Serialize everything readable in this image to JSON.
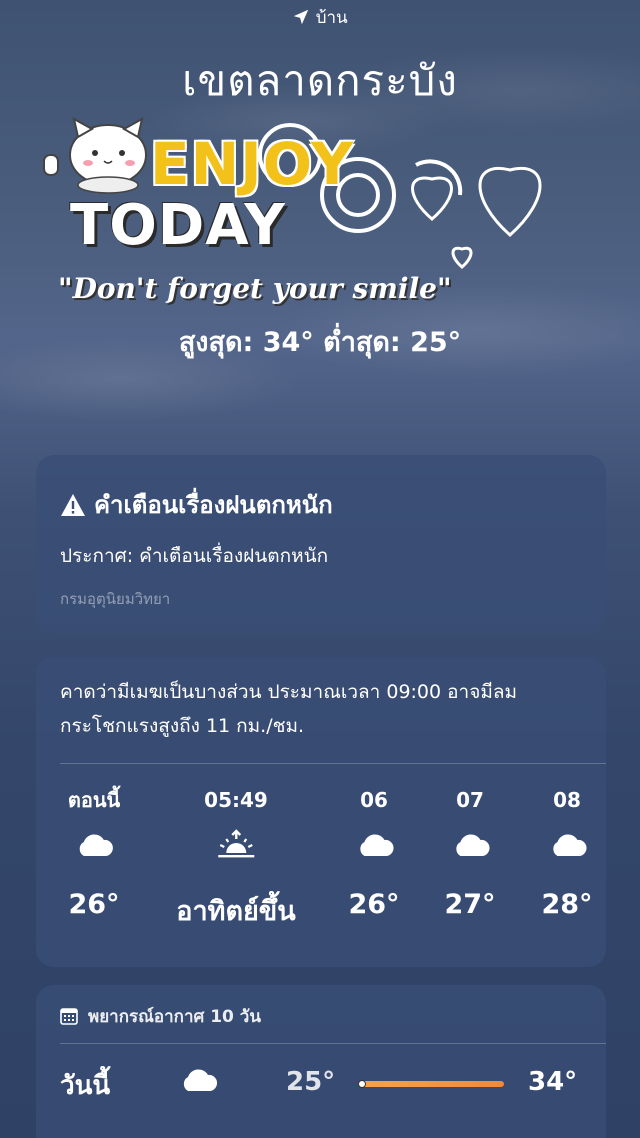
{
  "location": {
    "label": "บ้าน",
    "city": "เขตลาดกระบัง"
  },
  "sticker": {
    "line1": "ENJOY",
    "line2": "TODAY",
    "tagline": "\"Don't forget your smile\""
  },
  "hilo": "สูงสุด: 34°  ต่ำสุด: 25°",
  "alert": {
    "title": "คำเตือนเรื่องฝนตกหนัก",
    "body": "ประกาศ: คำเตือนเรื่องฝนตกหนัก",
    "source": "กรมอุตุนิยมวิทยา"
  },
  "hourly": {
    "summary_line1": "คาดว่ามีเมฆเป็นบางส่วน ประมาณเวลา 09:00 อาจมีลม",
    "summary_line2": "กระโชกแรงสูงถึง 11 กม./ชม.",
    "items": [
      {
        "time": "ตอนนี้",
        "icon": "cloud-icon",
        "temp": "26°"
      },
      {
        "time": "05:49",
        "icon": "sunrise-icon",
        "temp": "อาทิตย์ขึ้น"
      },
      {
        "time": "06",
        "icon": "cloud-icon",
        "temp": "26°"
      },
      {
        "time": "07",
        "icon": "cloud-icon",
        "temp": "27°"
      },
      {
        "time": "08",
        "icon": "cloud-icon",
        "temp": "28°"
      }
    ]
  },
  "daily": {
    "header": "พยากรณ์อากาศ 10 วัน",
    "rows": [
      {
        "day": "วันนี้",
        "icon": "cloud-icon",
        "low": "25°",
        "high": "34°",
        "range_start": 0.0,
        "range_end": 1.0,
        "current": 0.0
      }
    ]
  },
  "colors": {
    "sticker_yellow": "#f2c21b",
    "range_bar": "#f08a3a",
    "background": "#3e5175"
  }
}
